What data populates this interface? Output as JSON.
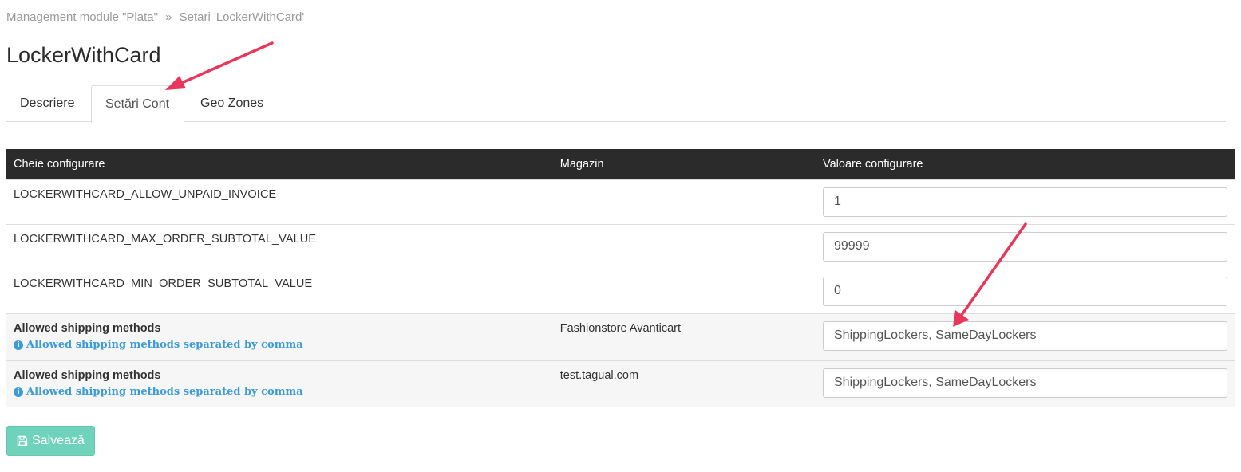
{
  "breadcrumb": {
    "parent": "Management module \"Plata\"",
    "separator": "»",
    "current": "Setari 'LockerWithCard'"
  },
  "page_title": "LockerWithCard",
  "tabs": [
    {
      "label": "Descriere",
      "active": false
    },
    {
      "label": "Setări Cont",
      "active": true
    },
    {
      "label": "Geo Zones",
      "active": false
    }
  ],
  "table": {
    "headers": [
      "Cheie configurare",
      "Magazin",
      "Valoare configurare"
    ],
    "rows": [
      {
        "key": "LOCKERWITHCARD_ALLOW_UNPAID_INVOICE",
        "hint": "",
        "store": "",
        "value": "1"
      },
      {
        "key": "LOCKERWITHCARD_MAX_ORDER_SUBTOTAL_VALUE",
        "hint": "",
        "store": "",
        "value": "99999"
      },
      {
        "key": "LOCKERWITHCARD_MIN_ORDER_SUBTOTAL_VALUE",
        "hint": "",
        "store": "",
        "value": "0"
      },
      {
        "key": "Allowed shipping methods",
        "hint": "Allowed shipping methods separated by comma",
        "store": "Fashionstore Avanticart",
        "value": "ShippingLockers, SameDayLockers"
      },
      {
        "key": "Allowed shipping methods",
        "hint": "Allowed shipping methods separated by comma",
        "store": "test.tagual.com",
        "value": "ShippingLockers, SameDayLockers"
      }
    ]
  },
  "save_button": {
    "label": "Salvează",
    "icon": "floppy-disk-icon"
  },
  "colors": {
    "header_bg": "#2b2b2b",
    "hint_blue": "#3d9bd9",
    "save_green": "#6fd3bb",
    "annotation_arrow": "#e8375a"
  }
}
